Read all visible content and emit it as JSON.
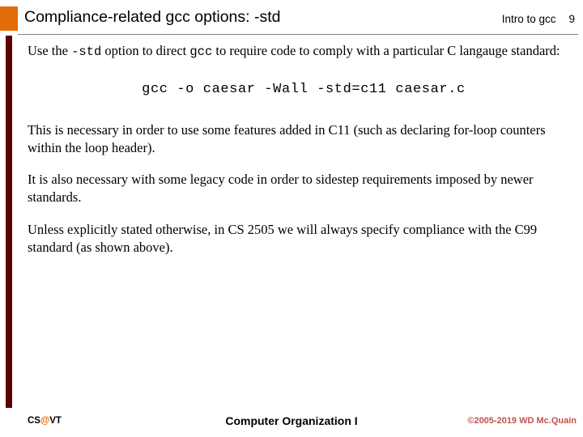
{
  "header": {
    "title": "Compliance-related gcc options:  -std",
    "right_label": "Intro to gcc",
    "page_number": "9"
  },
  "body": {
    "para1_part1": "Use the ",
    "para1_code1": "-std",
    "para1_part2": " option to direct ",
    "para1_code2": "gcc",
    "para1_part3": " to require code to comply with a particular C langauge standard:",
    "code_line": "gcc -o caesar -Wall -std=c11 caesar.c",
    "para2": "This is necessary in order to use some features added in C11 (such as declaring for-loop counters within the loop header).",
    "para3": "It is also necessary with some legacy code in order to sidestep requirements imposed by newer standards.",
    "para4": "Unless explicitly stated otherwise, in CS 2505 we will always specify compliance with the C99 standard (as shown above)."
  },
  "footer": {
    "left_cs": "CS",
    "left_at": "@",
    "left_vt": "VT",
    "center": "Computer Organization I",
    "right": "©2005-2019 WD Mc.Quain"
  },
  "colors": {
    "title_marker": "#E36C0A",
    "left_bar": "#5B0000",
    "footer_right": "#C0504D",
    "rule": "#808080"
  }
}
